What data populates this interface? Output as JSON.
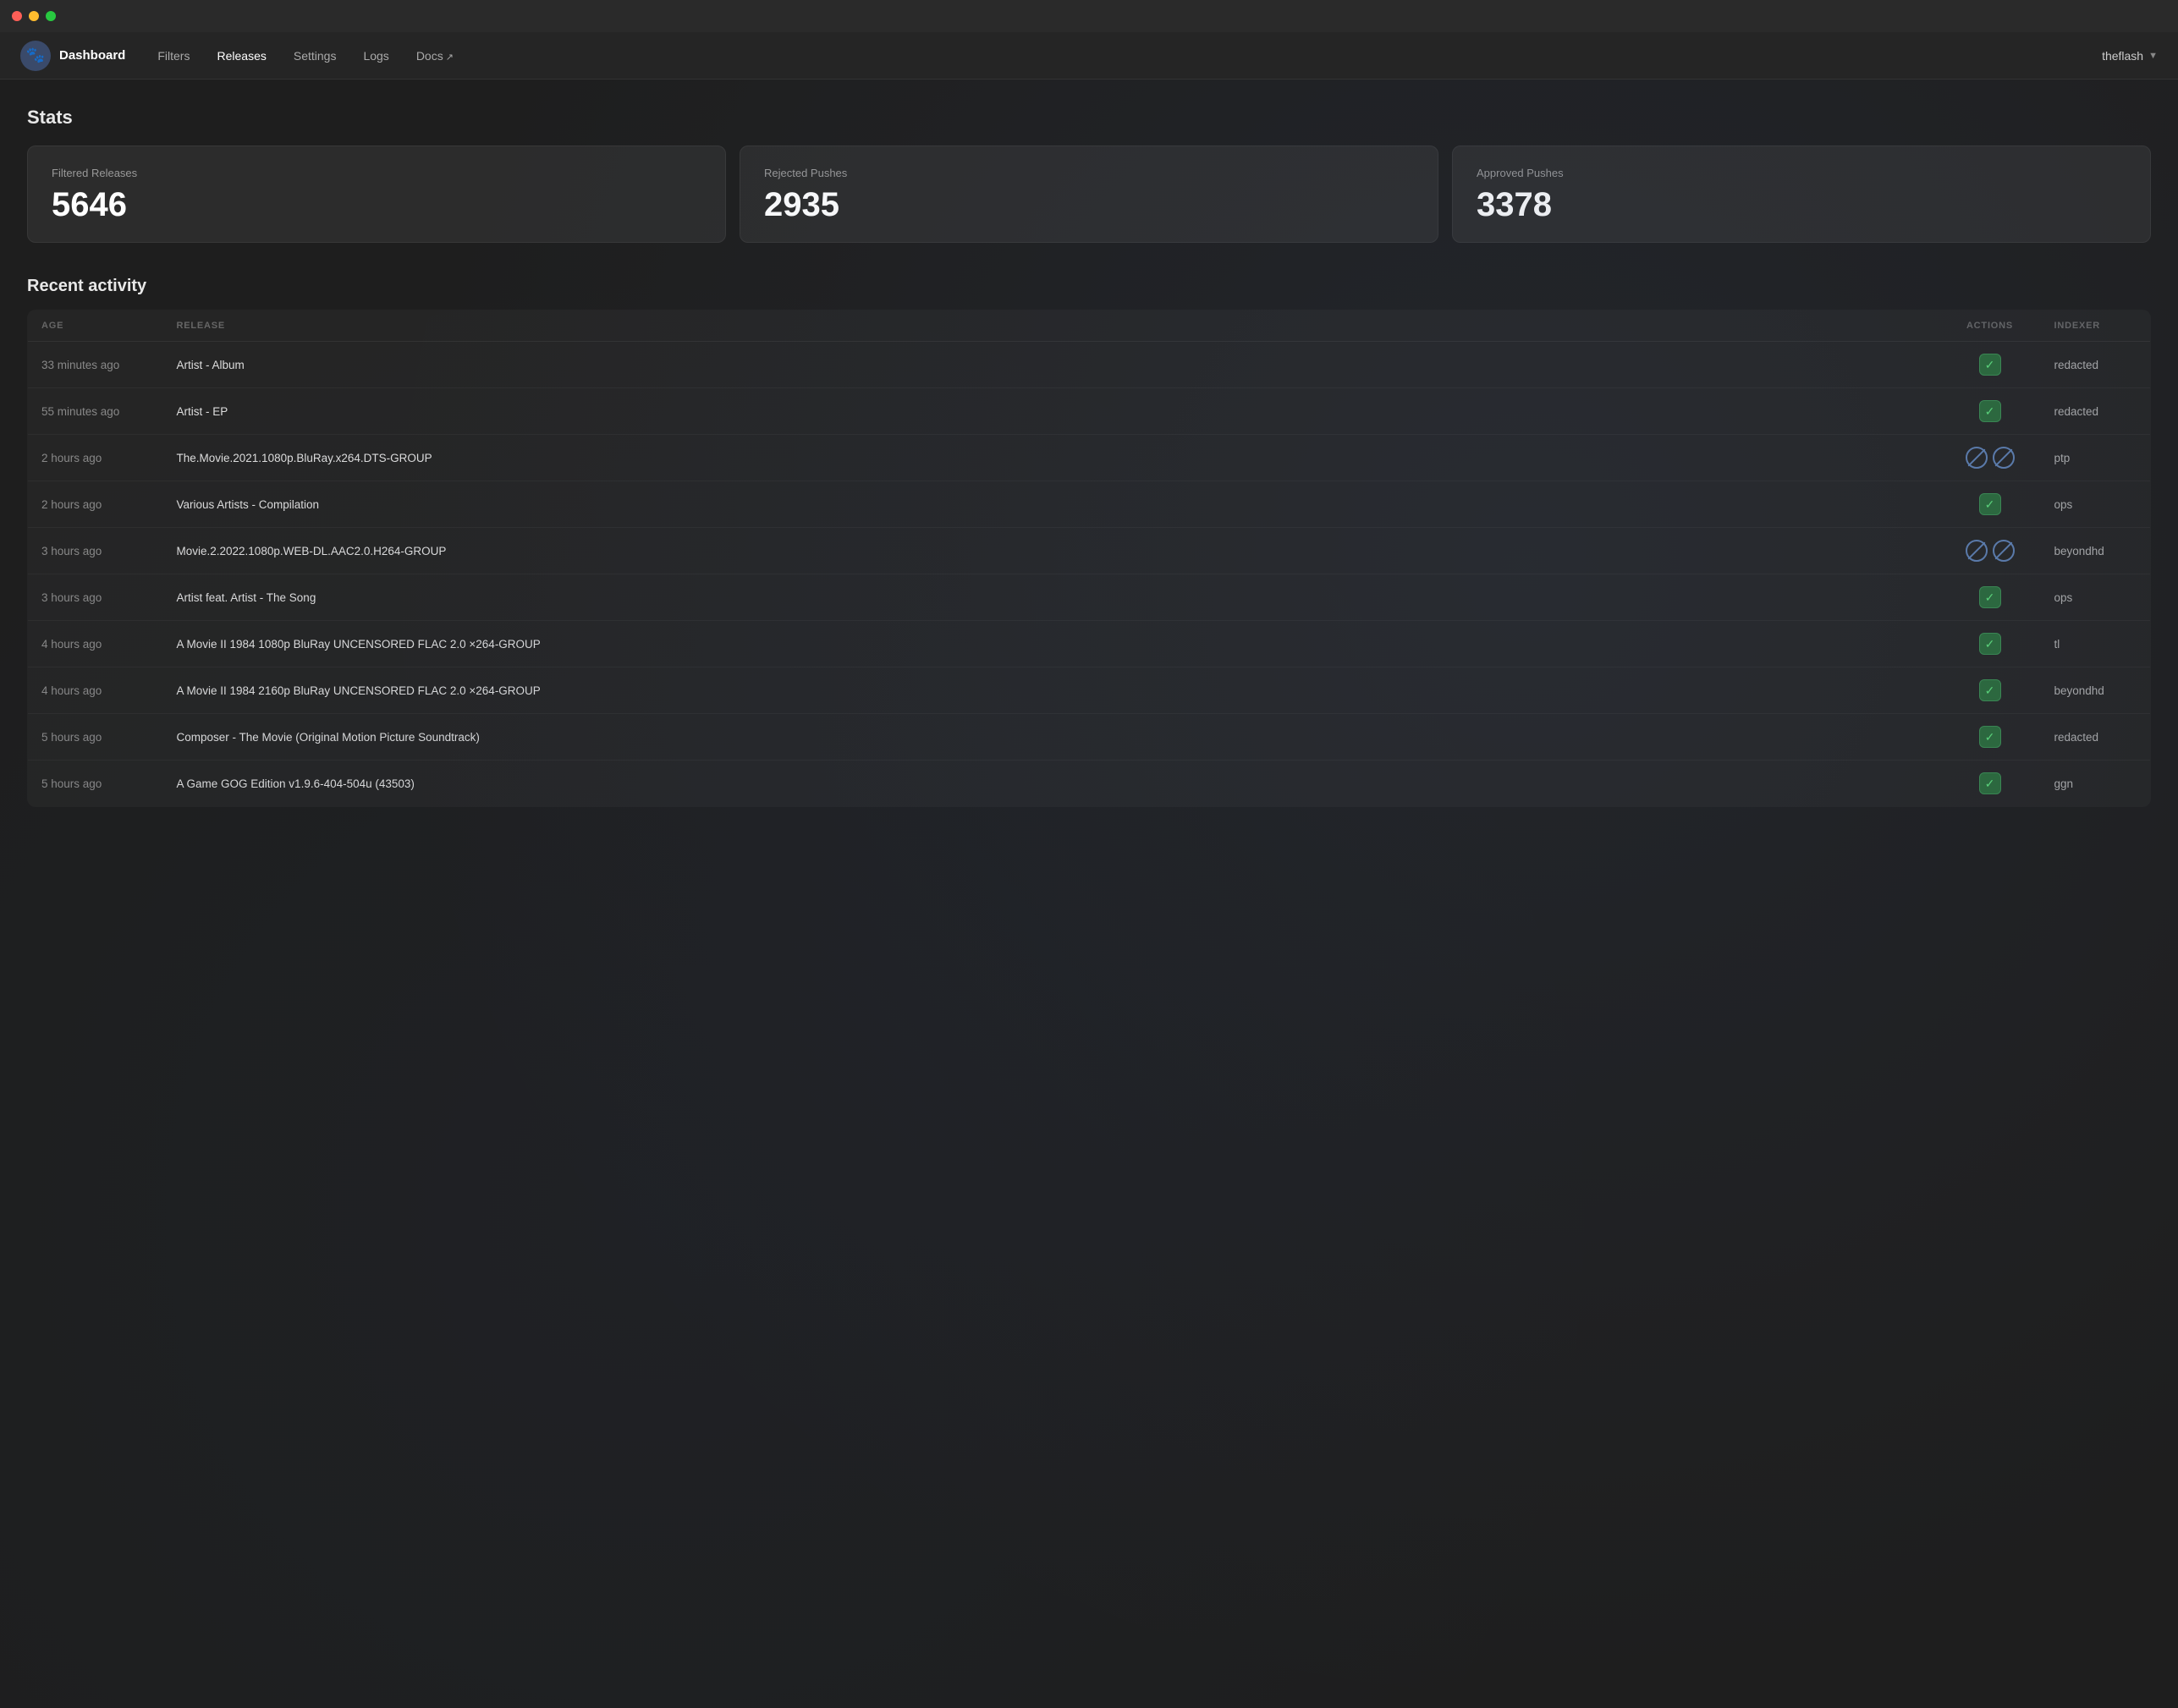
{
  "titlebar": {
    "traffic_lights": [
      "red",
      "yellow",
      "green"
    ]
  },
  "navbar": {
    "logo_emoji": "🐾",
    "brand": "Dashboard",
    "links": [
      {
        "label": "Filters",
        "active": false,
        "external": false
      },
      {
        "label": "Releases",
        "active": false,
        "external": false
      },
      {
        "label": "Settings",
        "active": false,
        "external": false
      },
      {
        "label": "Logs",
        "active": false,
        "external": false
      },
      {
        "label": "Docs",
        "active": false,
        "external": true
      }
    ],
    "user": "theflash"
  },
  "stats": {
    "title": "Stats",
    "cards": [
      {
        "label": "Filtered Releases",
        "value": "5646"
      },
      {
        "label": "Rejected Pushes",
        "value": "2935"
      },
      {
        "label": "Approved Pushes",
        "value": "3378"
      }
    ]
  },
  "activity": {
    "title": "Recent activity",
    "columns": [
      "AGE",
      "RELEASE",
      "ACTIONS",
      "INDEXER"
    ],
    "rows": [
      {
        "age": "33 minutes ago",
        "release": "Artist - Album",
        "action": "approve",
        "indexer": "redacted"
      },
      {
        "age": "55 minutes ago",
        "release": "Artist - EP",
        "action": "approve",
        "indexer": "redacted"
      },
      {
        "age": "2 hours ago",
        "release": "The.Movie.2021.1080p.BluRay.x264.DTS-GROUP",
        "action": "reject2",
        "indexer": "ptp"
      },
      {
        "age": "2 hours ago",
        "release": "Various Artists - Compilation",
        "action": "approve",
        "indexer": "ops"
      },
      {
        "age": "3 hours ago",
        "release": "Movie.2.2022.1080p.WEB-DL.AAC2.0.H264-GROUP",
        "action": "reject2",
        "indexer": "beyondhd"
      },
      {
        "age": "3 hours ago",
        "release": "Artist feat. Artist - The Song",
        "action": "approve",
        "indexer": "ops"
      },
      {
        "age": "4 hours ago",
        "release": "A Movie II 1984 1080p BluRay UNCENSORED FLAC 2.0 ×264-GROUP",
        "action": "approve",
        "indexer": "tl"
      },
      {
        "age": "4 hours ago",
        "release": "A Movie II 1984 2160p BluRay UNCENSORED FLAC 2.0 ×264-GROUP",
        "action": "approve",
        "indexer": "beyondhd"
      },
      {
        "age": "5 hours ago",
        "release": "Composer - The Movie (Original Motion Picture Soundtrack)",
        "action": "approve",
        "indexer": "redacted"
      },
      {
        "age": "5 hours ago",
        "release": "A Game GOG Edition v1.9.6-404-504u (43503)",
        "action": "approve",
        "indexer": "ggn"
      }
    ]
  }
}
